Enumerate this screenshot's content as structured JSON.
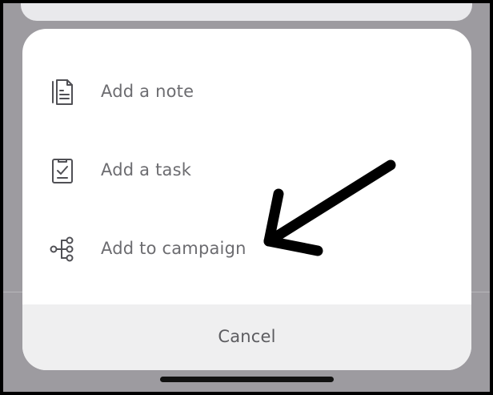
{
  "action_sheet": {
    "items": [
      {
        "label": "Add a note",
        "icon": "document-note-icon"
      },
      {
        "label": "Add a task",
        "icon": "task-checklist-icon"
      },
      {
        "label": "Add to campaign",
        "icon": "campaign-flow-icon"
      }
    ],
    "cancel_label": "Cancel"
  },
  "colors": {
    "backdrop": "#9d9ba0",
    "sheet": "#ffffff",
    "cancel_bg": "#efeff0",
    "text": "#6c6c70",
    "icon": "#505055",
    "annotation_arrow": "#000000"
  }
}
